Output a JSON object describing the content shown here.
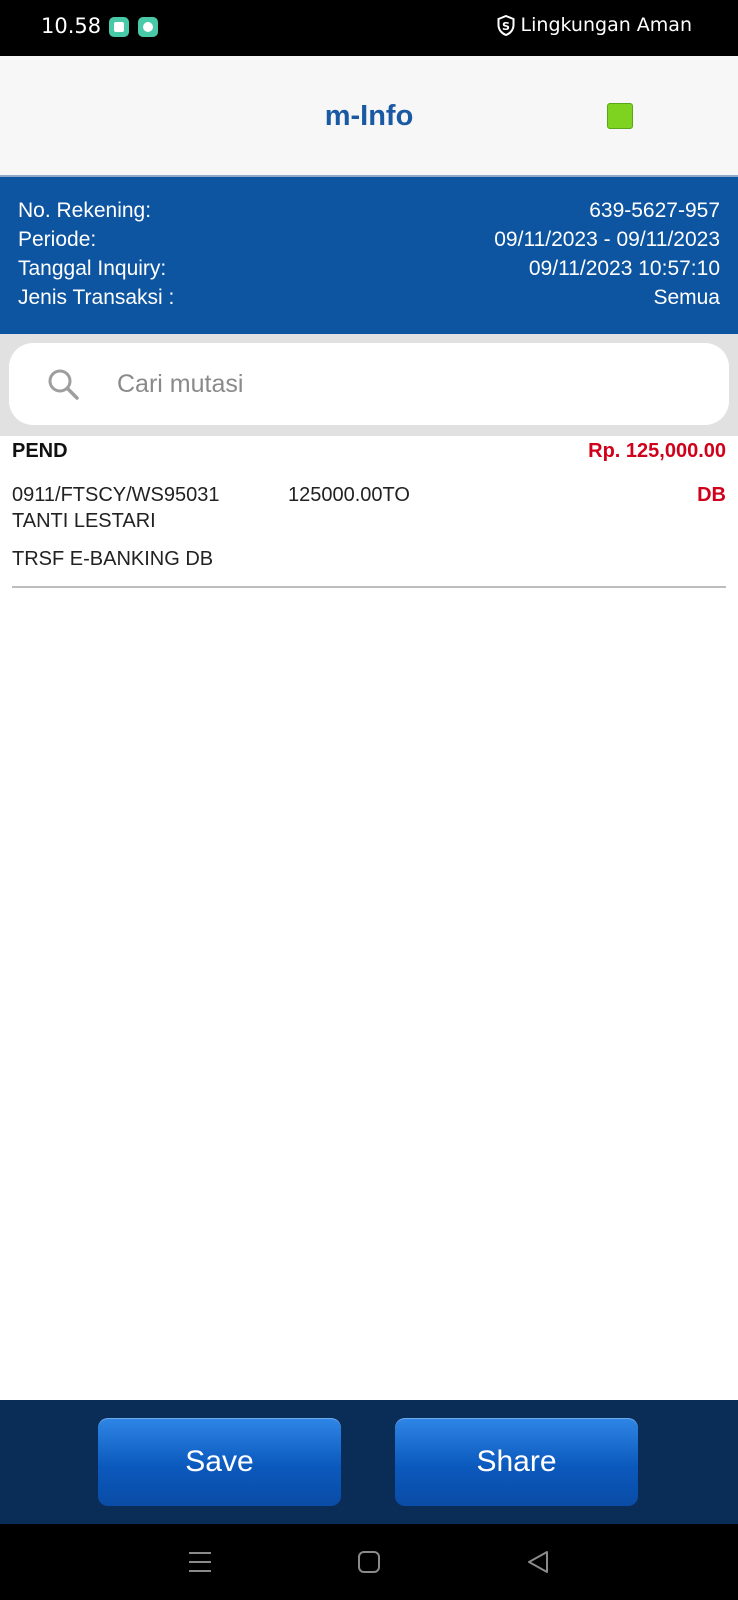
{
  "status_bar": {
    "time": "10.58",
    "security_label": "Lingkungan Aman",
    "icons": [
      "shield-s-icon"
    ]
  },
  "app_bar": {
    "title": "m-Info",
    "indicator_color": "#7ed321"
  },
  "account_info": {
    "rows": [
      {
        "label": "No. Rekening:",
        "value": "639-5627-957"
      },
      {
        "label": "Periode:",
        "value": "09/11/2023 - 09/11/2023"
      },
      {
        "label": "Tanggal Inquiry:",
        "value": "09/11/2023 10:57:10"
      },
      {
        "label": "Jenis Transaksi :",
        "value": "Semua"
      }
    ]
  },
  "search": {
    "placeholder": "Cari mutasi",
    "value": ""
  },
  "transactions": [
    {
      "status": "PEND",
      "amount": "Rp. 125,000.00",
      "reference": "0911/FTSCY/WS95031",
      "value": "125000.00TO",
      "type": "DB",
      "name": "TANTI LESTARI",
      "description": "TRSF E-BANKING DB"
    }
  ],
  "footer": {
    "save_label": "Save",
    "share_label": "Share"
  },
  "colors": {
    "brand_blue": "#0d55a0",
    "footer_navy": "#0a2d57",
    "debit_red": "#d0021b",
    "title_blue": "#1a5aa3"
  }
}
